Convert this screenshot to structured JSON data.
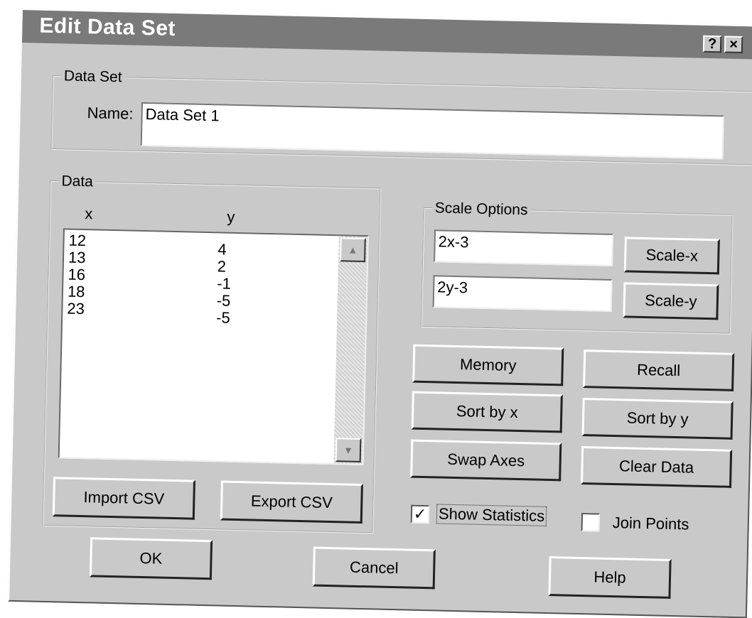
{
  "window": {
    "title": "Edit Data Set",
    "help_glyph": "?",
    "close_glyph": "×"
  },
  "dataset_group": {
    "legend": "Data Set",
    "name_label": "Name:",
    "name_value": "Data Set 1"
  },
  "data_group": {
    "legend": "Data",
    "col_x": "x",
    "col_y": "y",
    "rows": [
      {
        "x": "12",
        "y": "4"
      },
      {
        "x": "13",
        "y": "2"
      },
      {
        "x": "16",
        "y": "-1"
      },
      {
        "x": "18",
        "y": "-5"
      },
      {
        "x": "23",
        "y": "-5"
      }
    ],
    "import_label": "Import CSV",
    "export_label": "Export CSV"
  },
  "scale_group": {
    "legend": "Scale Options",
    "x_expr": "2x-3",
    "y_expr": "2y-3",
    "scale_x_label": "Scale-x",
    "scale_y_label": "Scale-y"
  },
  "actions": {
    "memory": "Memory",
    "recall": "Recall",
    "sort_x": "Sort by x",
    "sort_y": "Sort by y",
    "swap_axes": "Swap Axes",
    "clear_data": "Clear Data"
  },
  "options": {
    "show_statistics": "Show Statistics",
    "show_statistics_checked": true,
    "join_points": "Join Points",
    "join_points_checked": false
  },
  "footer": {
    "ok": "OK",
    "cancel": "Cancel",
    "help": "Help"
  },
  "icons": {
    "scroll_up": "▲",
    "scroll_down": "▼",
    "check": "✓"
  }
}
